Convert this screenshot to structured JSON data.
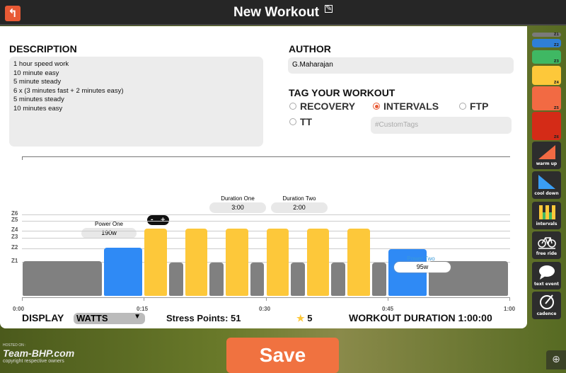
{
  "header": {
    "title": "New Workout",
    "back_icon": "back-arrow-icon",
    "edit_icon": "edit-icon"
  },
  "description": {
    "label": "DESCRIPTION",
    "lines": [
      "1 hour speed work",
      "10 minute easy",
      "5 minute steady",
      "6 x (3 minutes fast + 2 minutes easy)",
      "5 minutes steady",
      "10 minutes easy"
    ]
  },
  "author": {
    "label": "AUTHOR",
    "value": "G.Maharajan"
  },
  "tags": {
    "label": "TAG YOUR WORKOUT",
    "options": [
      {
        "label": "RECOVERY",
        "selected": false
      },
      {
        "label": "INTERVALS",
        "selected": true
      },
      {
        "label": "FTP",
        "selected": false
      },
      {
        "label": "TT",
        "selected": false
      }
    ],
    "custom_placeholder": "#CustomTags"
  },
  "chart_data": {
    "type": "bar",
    "zones": [
      "Z1",
      "Z2",
      "Z3",
      "Z4",
      "Z5",
      "Z6"
    ],
    "x_ticks": [
      "0:00",
      "0:15",
      "0:30",
      "0:45",
      "1:00"
    ],
    "xlim_minutes": [
      0,
      60
    ],
    "segments": [
      {
        "minutes": 10,
        "level": 0.43,
        "color": "#808080"
      },
      {
        "minutes": 5,
        "level": 0.59,
        "color": "#2f8af5"
      },
      {
        "minutes": 3,
        "level": 0.83,
        "color": "#fdc83a"
      },
      {
        "minutes": 2,
        "level": 0.41,
        "color": "#808080"
      },
      {
        "minutes": 3,
        "level": 0.83,
        "color": "#fdc83a"
      },
      {
        "minutes": 2,
        "level": 0.41,
        "color": "#808080"
      },
      {
        "minutes": 3,
        "level": 0.83,
        "color": "#fdc83a"
      },
      {
        "minutes": 2,
        "level": 0.41,
        "color": "#808080"
      },
      {
        "minutes": 3,
        "level": 0.83,
        "color": "#fdc83a"
      },
      {
        "minutes": 2,
        "level": 0.41,
        "color": "#808080"
      },
      {
        "minutes": 3,
        "level": 0.83,
        "color": "#fdc83a"
      },
      {
        "minutes": 2,
        "level": 0.41,
        "color": "#808080"
      },
      {
        "minutes": 3,
        "level": 0.83,
        "color": "#fdc83a"
      },
      {
        "minutes": 2,
        "level": 0.41,
        "color": "#808080"
      },
      {
        "minutes": 5,
        "level": 0.57,
        "color": "#2f8af5"
      },
      {
        "minutes": 10,
        "level": 0.43,
        "color": "#808080"
      }
    ],
    "annotations": {
      "power_one_label": "Power One",
      "power_one_value": "190w",
      "power_two_label": "Power Two",
      "power_two_value": "95w",
      "duration_one_label": "Duration One",
      "duration_one_value": "3:00",
      "duration_two_label": "Duration Two",
      "duration_two_value": "2:00",
      "stepper_minus": "-",
      "stepper_plus": "+"
    }
  },
  "footer": {
    "display_label": "DISPLAY",
    "display_value": "WATTS",
    "stress_points": "Stress Points: 51",
    "stars": "5",
    "duration": "WORKOUT DURATION 1:00:00"
  },
  "palette": {
    "zones": [
      {
        "label": "Z1",
        "color": "#7a7a7a"
      },
      {
        "label": "Z2",
        "color": "#2f7fd6"
      },
      {
        "label": "Z3",
        "color": "#3fb863"
      },
      {
        "label": "Z4",
        "color": "#fdc83a"
      },
      {
        "label": "Z5",
        "color": "#f26a43"
      },
      {
        "label": "Z6",
        "color": "#d42b17"
      }
    ],
    "tools": [
      {
        "label": "warm up",
        "icon": "warm-up-icon"
      },
      {
        "label": "cool down",
        "icon": "cool-down-icon"
      },
      {
        "label": "intervals",
        "icon": "intervals-icon"
      },
      {
        "label": "free ride",
        "icon": "bicycle-icon"
      },
      {
        "label": "text event",
        "icon": "speech-bubble-icon"
      },
      {
        "label": "cadence",
        "icon": "cadence-icon"
      }
    ]
  },
  "save_label": "Save",
  "watermark": {
    "hosted": "HOSTED ON :",
    "brand": "Team-BHP.com",
    "copyright": "copyright respective owners"
  }
}
